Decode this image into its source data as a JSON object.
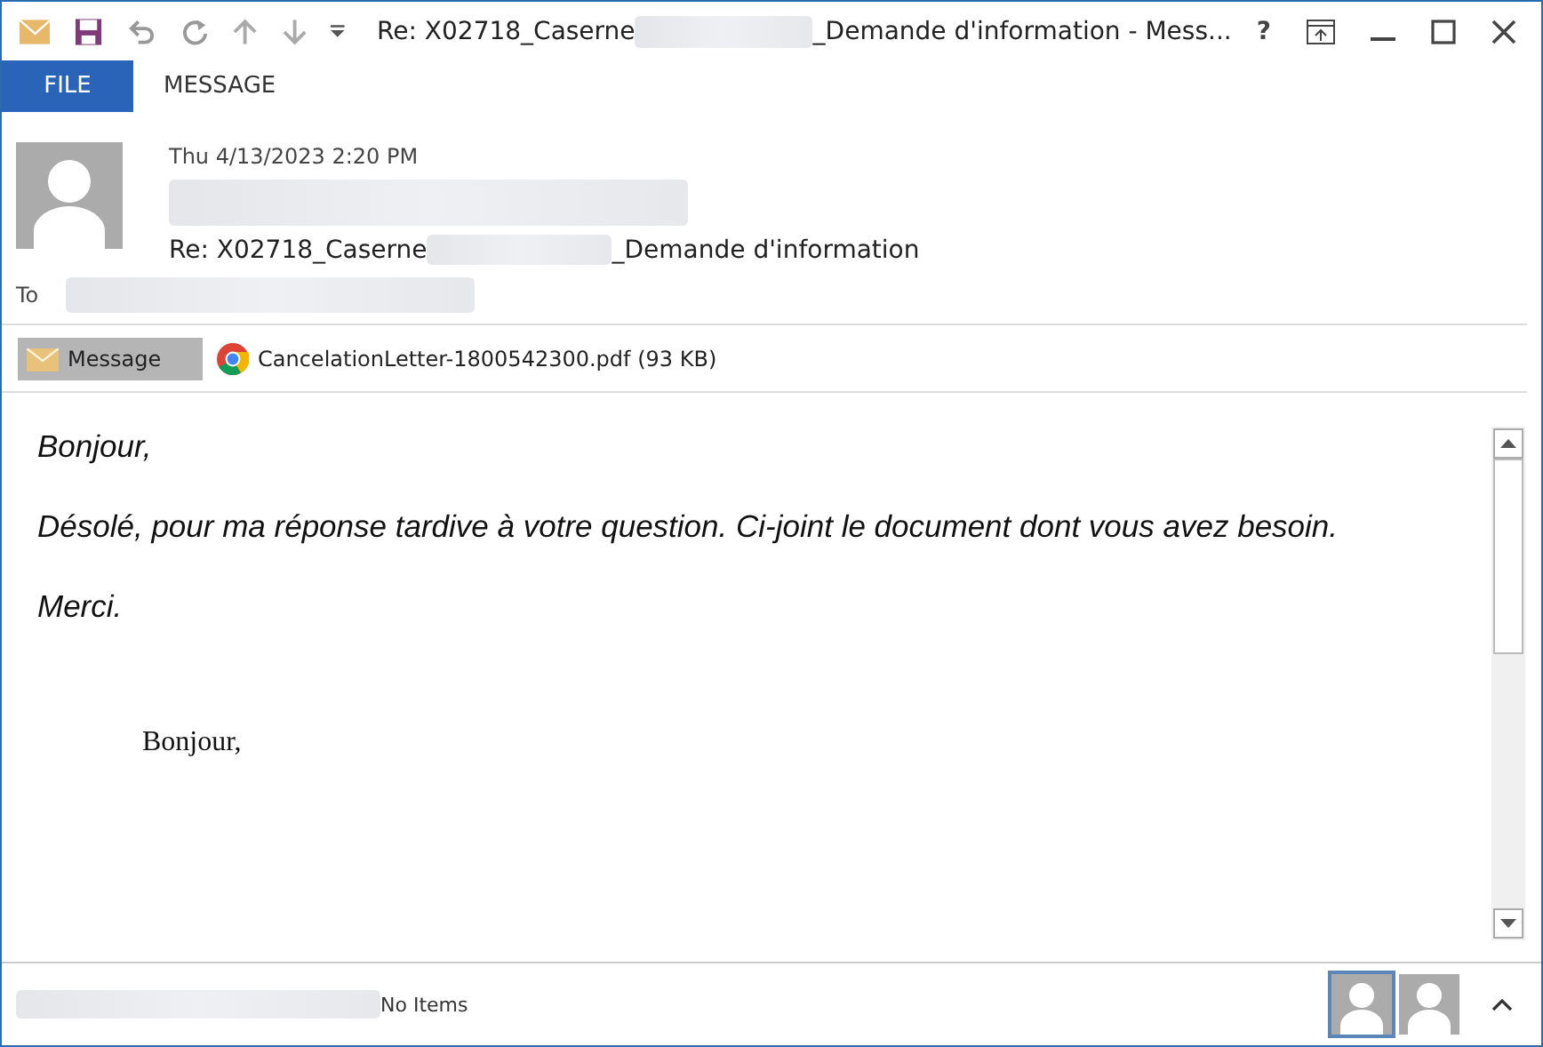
{
  "window": {
    "title_start": "Re: X02718_Caserne",
    "title_end": "_Demande d'information - Mess...",
    "buttons": [
      "?"
    ]
  },
  "tabs": [
    {
      "label": "FILE",
      "selected": true
    },
    {
      "label": "MESSAGE",
      "selected": false
    }
  ],
  "header": {
    "date": "Thu 4/13/2023 2:20 PM",
    "subject_start": "Re: X02718_Caserne",
    "subject_end": "_Demande d'information",
    "to_label": "To"
  },
  "attachments": [
    {
      "kind": "message",
      "label": "Message",
      "selected": true
    },
    {
      "kind": "pdf",
      "label": "CancelationLetter-1800542300.pdf (93 KB)",
      "selected": false
    }
  ],
  "body": {
    "paragraphs": [
      "Bonjour,",
      "Désolé, pour ma réponse tardive à votre question. Ci-joint le document dont vous avez besoin.",
      "Merci."
    ],
    "quoted": [
      "Bonjour,"
    ]
  },
  "status_bar": {
    "text": "No Items"
  }
}
